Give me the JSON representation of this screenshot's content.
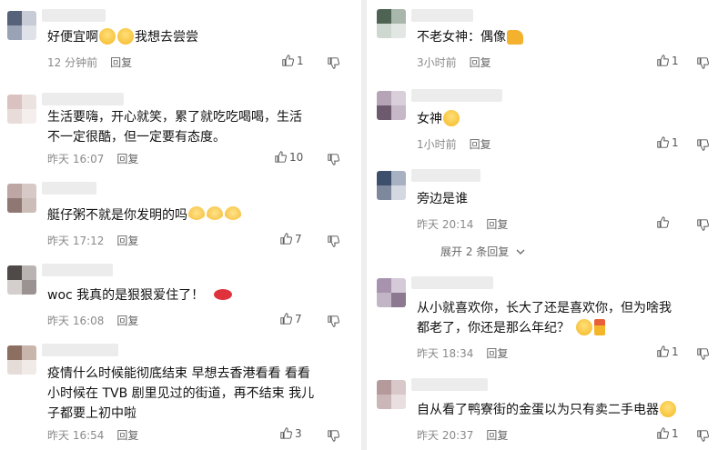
{
  "left": [
    {
      "text": [
        "好便宜啊",
        "我想去尝尝"
      ],
      "time": "12 分钟前",
      "reply": "回复",
      "likes": "1"
    },
    {
      "text": [
        "生活要嗨，开心就笑，累了就吃吃喝喝，生活",
        "不一定很酷，但一定要有态度。"
      ],
      "time": "昨天 16:07",
      "reply": "回复",
      "likes": "10"
    },
    {
      "text": [
        "艇仔粥不就是你发明的吗"
      ],
      "time": "昨天 17:12",
      "reply": "回复",
      "likes": "7"
    },
    {
      "text": [
        "woc 我真的是狠狠爱住了！"
      ],
      "time": "昨天 16:08",
      "reply": "回复",
      "likes": "7"
    },
    {
      "text": [
        "疫情什么时候能彻底结束 早想去香港看看 看看",
        "小时候在 TVB 剧里见过的街道，再不结束 我儿",
        "子都要上初中啦"
      ],
      "time": "昨天 16:54",
      "reply": "回复",
      "likes": "3"
    }
  ],
  "right": [
    {
      "text": [
        "不老女神：偶像"
      ],
      "time": "3小时前",
      "reply": "回复",
      "likes": "1"
    },
    {
      "text": [
        "女神"
      ],
      "time": "1小时前",
      "reply": "回复",
      "likes": "1"
    },
    {
      "text": [
        "旁边是谁"
      ],
      "time": "昨天 20:14",
      "reply": "回复",
      "likes": ""
    },
    {
      "text": [
        "从小就喜欢你，长大了还是喜欢你，但为啥我",
        "都老了，你还是那么年纪？"
      ],
      "time": "昨天 18:34",
      "reply": "回复",
      "likes": "1"
    },
    {
      "text": [
        "自从看了鸭寮街的金蛋以为只有卖二手电器"
      ],
      "time": "昨天 20:37",
      "reply": "回复",
      "likes": "1"
    }
  ],
  "expand_label": "展开 2 条回复",
  "icons": {
    "like": "thumbs-up-icon",
    "dislike": "thumbs-down-icon"
  }
}
